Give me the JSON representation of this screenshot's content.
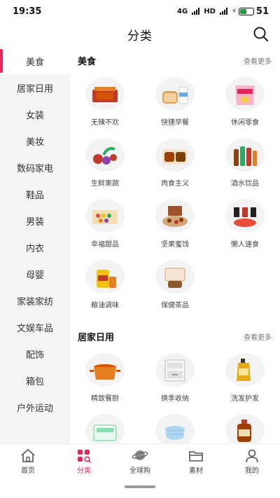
{
  "status_bar": {
    "time": "19:35",
    "network_1": "4G",
    "network_2": "HD",
    "battery_level": "51",
    "battery_fill_fraction": 0.51
  },
  "header": {
    "title": "分类"
  },
  "sidebar": {
    "items": [
      {
        "label": "美食",
        "active": true
      },
      {
        "label": "居家日用"
      },
      {
        "label": "女装"
      },
      {
        "label": "美妆"
      },
      {
        "label": "数码家电"
      },
      {
        "label": "鞋品"
      },
      {
        "label": "男装"
      },
      {
        "label": "内衣"
      },
      {
        "label": "母婴"
      },
      {
        "label": "家装家纺"
      },
      {
        "label": "文娱车品"
      },
      {
        "label": "配饰"
      },
      {
        "label": "箱包"
      },
      {
        "label": "户外运动"
      }
    ]
  },
  "sections": [
    {
      "title": "美食",
      "more": "查看更多",
      "items": [
        {
          "label": "无辣不欢",
          "icon": "spicy-snack-icon"
        },
        {
          "label": "快捷早餐",
          "icon": "bread-milk-icon"
        },
        {
          "label": "休闲零食",
          "icon": "snack-bag-icon"
        },
        {
          "label": "生鲜果蔬",
          "icon": "fruit-icon"
        },
        {
          "label": "肉食主义",
          "icon": "meat-icon"
        },
        {
          "label": "酒水饮品",
          "icon": "bottles-icon"
        },
        {
          "label": "幸福甜品",
          "icon": "dessert-box-icon"
        },
        {
          "label": "坚果蜜饯",
          "icon": "nuts-icon"
        },
        {
          "label": "懒人速食",
          "icon": "instant-noodle-icon"
        },
        {
          "label": "粮油调味",
          "icon": "cooking-oil-icon"
        },
        {
          "label": "保健茶品",
          "icon": "health-tea-icon"
        }
      ]
    },
    {
      "title": "居家日用",
      "more": "查看更多",
      "items": [
        {
          "label": "精致餐厨",
          "icon": "cooking-pot-icon"
        },
        {
          "label": "换季收纳",
          "icon": "storage-drawer-icon"
        },
        {
          "label": "洗发护发",
          "icon": "shampoo-bottle-icon"
        },
        {
          "label": "",
          "icon": "tissue-pack-icon"
        },
        {
          "label": "",
          "icon": "face-mask-icon"
        },
        {
          "label": "",
          "icon": "disinfectant-bottle-icon"
        }
      ]
    }
  ],
  "bottom_nav": [
    {
      "label": "首页",
      "icon": "home-icon"
    },
    {
      "label": "分类",
      "icon": "category-icon",
      "active": true
    },
    {
      "label": "全球购",
      "icon": "planet-icon"
    },
    {
      "label": "素材",
      "icon": "folder-icon"
    },
    {
      "label": "我的",
      "icon": "user-icon"
    }
  ],
  "colors": {
    "accent": "#e8255a",
    "sidebar_bg": "#f5f5f5",
    "thumb_bg": "#f3f3f3"
  }
}
